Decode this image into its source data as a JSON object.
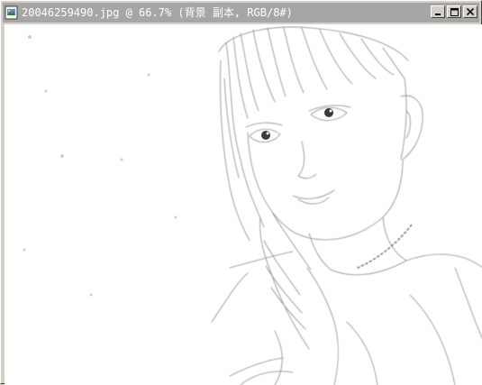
{
  "window": {
    "title": "20046259490.jpg @ 66.7% (背景 副本, RGB/8#)",
    "controls": {
      "minimize_icon": "minimize-icon",
      "maximize_icon": "maximize-icon",
      "close_icon": "close-icon"
    },
    "colors": {
      "titlebar_inactive": "#a6a6a6",
      "title_text": "#ffffff",
      "frame": "#d4d0c8",
      "canvas_background": "#ffffff"
    }
  },
  "document": {
    "filename": "20046259490.jpg",
    "zoom": "66.7%",
    "layer": "背景 副本",
    "mode": "RGB/8#",
    "image_description_icon": "pencil-sketch-portrait"
  }
}
